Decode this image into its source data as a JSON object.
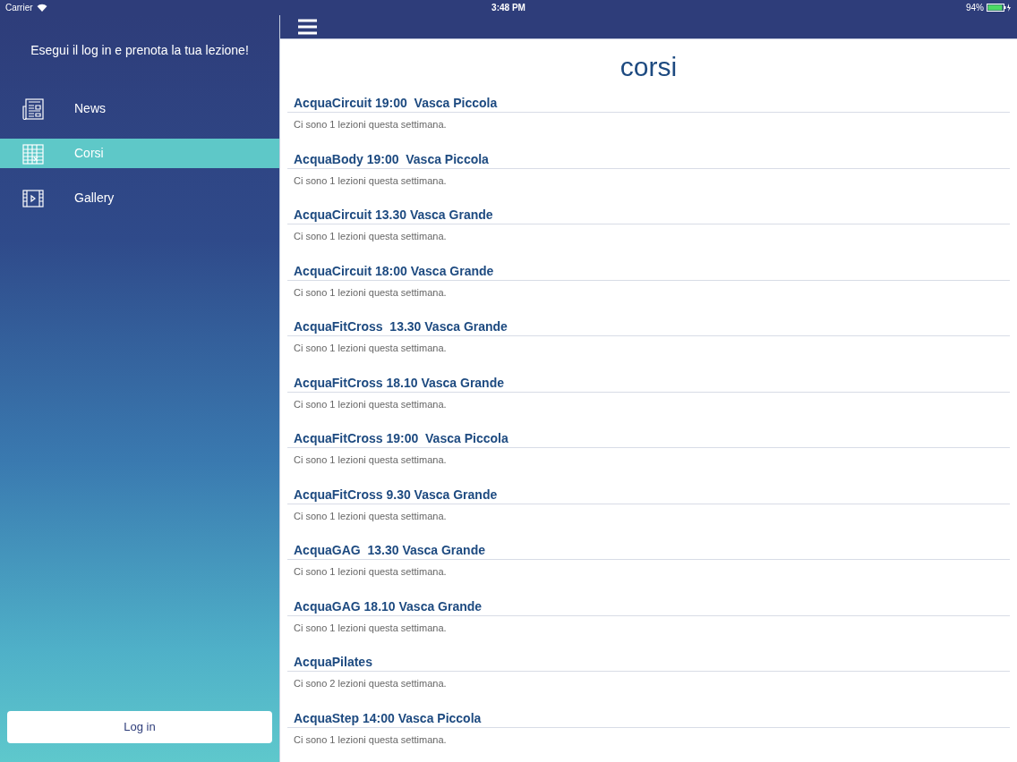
{
  "status_bar": {
    "carrier": "Carrier",
    "time": "3:48 PM",
    "battery": "94%"
  },
  "sidebar": {
    "prompt": "Esegui il log in e prenota la tua lezione!",
    "items": [
      {
        "label": "News",
        "kind": "news",
        "selected": false
      },
      {
        "label": "Corsi",
        "kind": "calendar",
        "selected": true
      },
      {
        "label": "Gallery",
        "kind": "video",
        "selected": false
      }
    ],
    "login_button": "Log in"
  },
  "page": {
    "title": "corsi",
    "courses": [
      {
        "title": "AcquaCircuit 19:00  Vasca Piccola",
        "subtitle": "Ci sono 1 lezioni questa settimana."
      },
      {
        "title": "AcquaBody 19:00  Vasca Piccola",
        "subtitle": "Ci sono 1 lezioni questa settimana."
      },
      {
        "title": "AcquaCircuit 13.30 Vasca Grande",
        "subtitle": "Ci sono 1 lezioni questa settimana."
      },
      {
        "title": "AcquaCircuit 18:00 Vasca Grande",
        "subtitle": "Ci sono 1 lezioni questa settimana."
      },
      {
        "title": "AcquaFitCross  13.30 Vasca Grande",
        "subtitle": "Ci sono 1 lezioni questa settimana."
      },
      {
        "title": "AcquaFitCross 18.10 Vasca Grande",
        "subtitle": "Ci sono 1 lezioni questa settimana."
      },
      {
        "title": "AcquaFitCross 19:00  Vasca Piccola",
        "subtitle": "Ci sono 1 lezioni questa settimana."
      },
      {
        "title": "AcquaFitCross 9.30 Vasca Grande",
        "subtitle": "Ci sono 1 lezioni questa settimana."
      },
      {
        "title": "AcquaGAG  13.30 Vasca Grande",
        "subtitle": "Ci sono 1 lezioni questa settimana."
      },
      {
        "title": "AcquaGAG 18.10 Vasca Grande",
        "subtitle": "Ci sono 1 lezioni questa settimana."
      },
      {
        "title": "AcquaPilates",
        "subtitle": "Ci sono 2 lezioni questa settimana."
      },
      {
        "title": "AcquaStep 14:00 Vasca Piccola",
        "subtitle": "Ci sono 1 lezioni questa settimana."
      }
    ]
  }
}
